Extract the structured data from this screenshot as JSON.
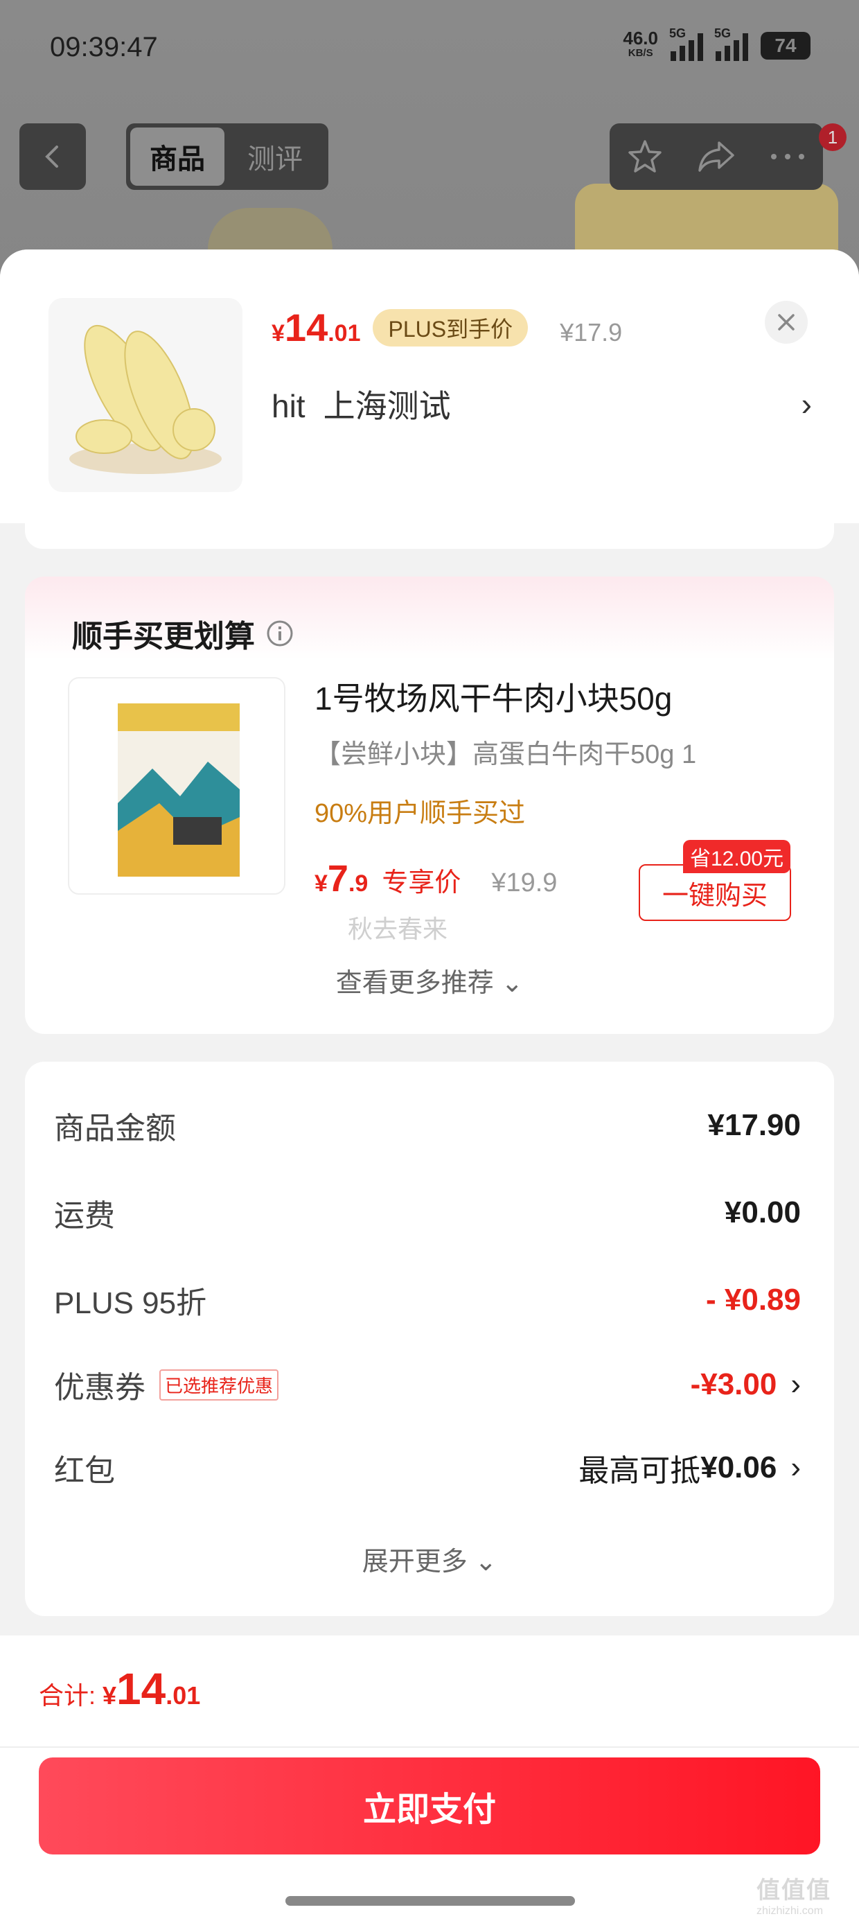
{
  "status_bar": {
    "time": "09:39:47",
    "net_speed": "46.0",
    "net_unit": "KB/S",
    "sim1": "5G",
    "sim2": "5G",
    "battery": "74"
  },
  "nav": {
    "tab_product": "商品",
    "tab_review": "测评",
    "cart_badge": "1"
  },
  "product": {
    "price_currency": "¥",
    "price_int": "14",
    "price_dec": ".01",
    "plus_label": "PLUS到手价",
    "original_price": "¥17.9",
    "address_user": "hit",
    "address_city": "上海测试",
    "address_chevron": "›"
  },
  "upsell": {
    "title": "顺手买更划算",
    "item_name": "1号牧场风干牛肉小块50g",
    "item_desc": "【尝鲜小块】高蛋白牛肉干50g  1",
    "hint": "90%用户顺手买过",
    "price_currency": "¥",
    "price_int": "7",
    "price_dec": ".9",
    "price_label": "专享价",
    "original_price": "¥19.9",
    "watermark": "秋去春来",
    "save_tag": "省12.00元",
    "buy_button": "一键购买",
    "more": "查看更多推荐 ⌄"
  },
  "summary": {
    "rows": [
      {
        "label": "商品金额",
        "value": "¥17.90"
      },
      {
        "label": "运费",
        "value": "¥0.00"
      },
      {
        "label": "PLUS 95折",
        "value": "- ¥0.89"
      },
      {
        "label": "优惠券",
        "tag": "已选推荐优惠",
        "value": "-¥3.00"
      },
      {
        "label": "红包",
        "value_prefix": "最高可抵",
        "value": "¥0.06"
      }
    ],
    "expand": "展开更多 ⌄"
  },
  "footer": {
    "total_label": "合计:",
    "total_currency": "¥",
    "total_int": "14",
    "total_dec": ".01",
    "pay_button": "立即支付",
    "site_mark": "值值值",
    "site_url": "zhizhizhi.com"
  },
  "colors": {
    "accent_red": "#e8231a",
    "plus_gold": "#f7e2ad",
    "pay_button": "#ff1525"
  }
}
